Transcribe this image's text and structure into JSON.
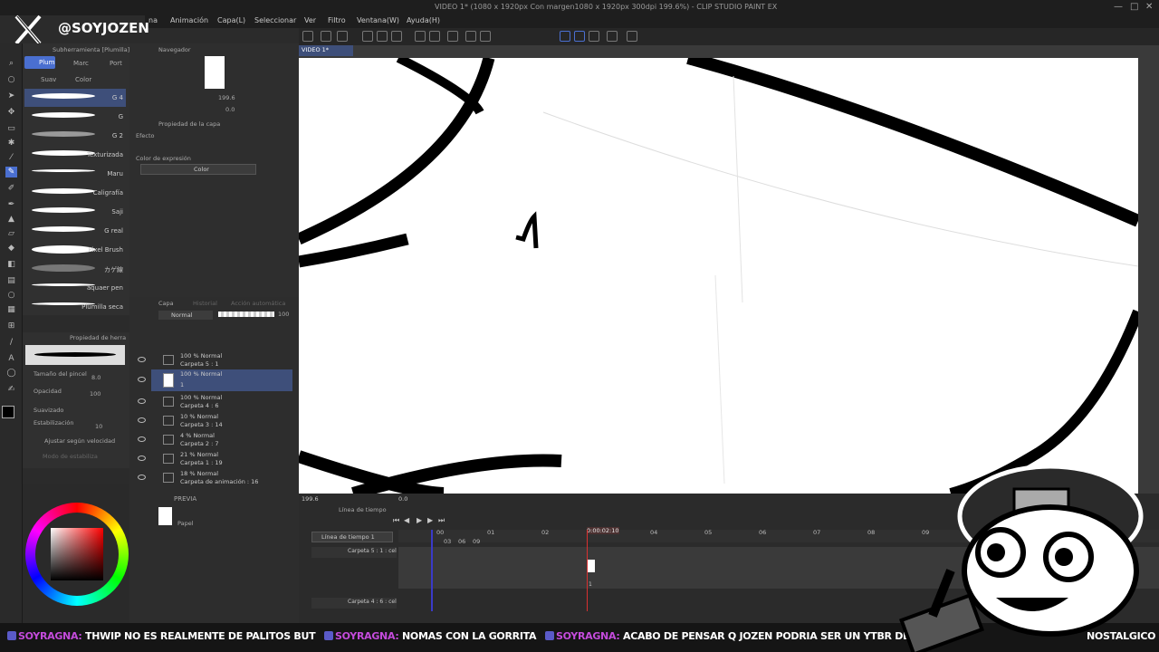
{
  "window": {
    "title": "VIDEO 1* (1080 x 1920px Con margen1080 x 1920px 300dpi 199.6%) - CLIP STUDIO PAINT EX",
    "controls": [
      "—",
      "□",
      "✕"
    ]
  },
  "menu": [
    "na",
    "Animación",
    "Capa(L)",
    "Seleccionar",
    "Ver",
    "Filtro",
    "Ventana(W)",
    "Ayuda(H)"
  ],
  "logo": {
    "handle": "@SOYJOZEN",
    "icon": "x-logo-icon"
  },
  "canvas_tab": "VIDEO 1*",
  "subtool": {
    "header": "Subherramienta [Plumilla]",
    "tabs": [
      "Plum",
      "Marc",
      "Port"
    ],
    "subtabs": [
      "Suav",
      "Color"
    ],
    "brushes": [
      "G 4",
      "G",
      "G 2",
      "Texturizada",
      "Maru",
      "Caligrafía",
      "Saji",
      "G real",
      "Pixel Brush",
      "カゲ線",
      "aquaer pen",
      "Plumilla seca"
    ]
  },
  "navigator": {
    "tab": "Navegador",
    "zoom": "199.6",
    "angle": "0.0"
  },
  "layer_property": {
    "tab": "Propiedad de la capa",
    "effect_label": "Efecto",
    "expression_label": "Color de expresión",
    "expression_value": "Color"
  },
  "tool_property": {
    "tab": "Propiedad de herra",
    "brush_size_label": "Tamaño del pincel",
    "brush_size": "8.0",
    "opacity_label": "Opacidad",
    "opacity": "100",
    "smoothing_label": "Suavizado",
    "stabilization_label": "Estabilización",
    "stabilization": "10",
    "speed_label": "Ajustar según velocidad",
    "mode_label": "Modo de estabiliza"
  },
  "layers_panel": {
    "tabs": [
      "Capa",
      "Historial",
      "Acción automática"
    ],
    "blend_mode": "Normal",
    "opacity": "100",
    "layers": [
      {
        "line1": "100 % Normal",
        "line2": "Carpeta 5 : 1"
      },
      {
        "line1": "100 % Normal",
        "line2": "1"
      },
      {
        "line1": "100 % Normal",
        "line2": "Carpeta 4 : 6"
      },
      {
        "line1": "10 % Normal",
        "line2": "Carpeta 3 : 14"
      },
      {
        "line1": "4 % Normal",
        "line2": "Carpeta 2 : 7"
      },
      {
        "line1": "21 % Normal",
        "line2": "Carpeta 1 : 19"
      },
      {
        "line1": "18 % Normal",
        "line2": "Carpeta de animación : 16"
      }
    ],
    "preview_label": "PREVIA",
    "paper_label": "Papel"
  },
  "status": {
    "zoom": "199.6",
    "angle": "0.0"
  },
  "timeline": {
    "tab": "Línea de tiempo",
    "name": "Línea de tiempo 1",
    "current_time": "0:00:02:10",
    "seconds": [
      "00",
      "01",
      "02",
      "04",
      "05",
      "06",
      "07",
      "08",
      "09"
    ],
    "sub_frames": [
      "03",
      "06",
      "09"
    ],
    "tracks": [
      {
        "label": "Carpeta 5 : 1 : cel",
        "cel": "1"
      },
      {
        "label": "Carpeta 4 : 6 : cel"
      }
    ]
  },
  "chat": [
    {
      "user": "SOYRAGNA:",
      "text": "THWIP NO ES REALMENTE DE PALITOS BUT"
    },
    {
      "user": "SOYRAGNA:",
      "text": "NOMAS CON LA GORRITA"
    },
    {
      "user": "SOYRAGNA:",
      "text": "ACABO DE PENSAR Q JOZEN PODRIA SER UN YTBR DE PA"
    },
    {
      "user": "",
      "text": "NOSTALGICO"
    }
  ],
  "colors": {
    "accent": "#4a6fd0",
    "playhead": "#d83030",
    "chat_user": "#c44bdc"
  }
}
